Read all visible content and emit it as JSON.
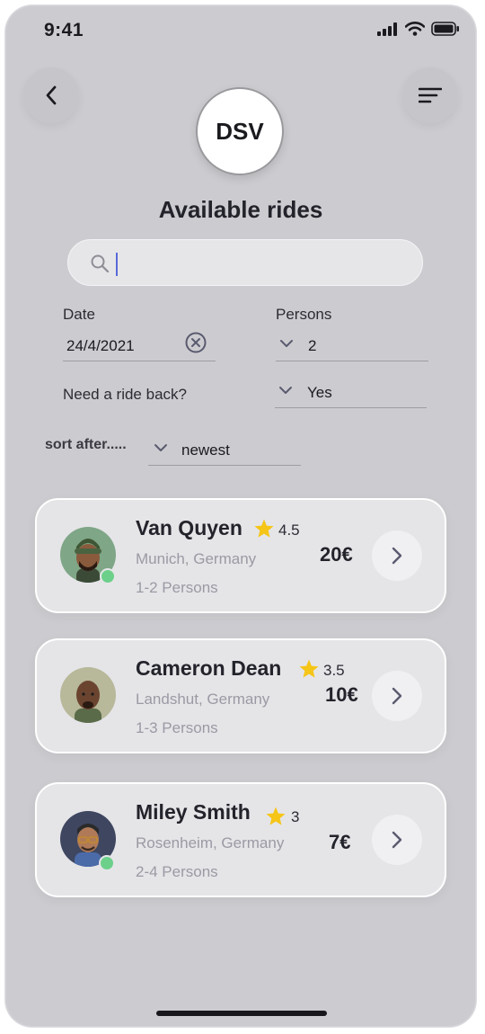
{
  "status_bar": {
    "time": "9:41"
  },
  "header": {
    "logo_text": "DSV",
    "title": "Available rides"
  },
  "search": {
    "value": "",
    "placeholder": ""
  },
  "filters": {
    "date_label": "Date",
    "date_value": "24/4/2021",
    "persons_label": "Persons",
    "persons_value": "2",
    "ride_back_label": "Need a ride back?",
    "ride_back_value": "Yes",
    "sort_label": "sort after.....",
    "sort_value": "newest"
  },
  "rides": [
    {
      "name": "Van Quyen",
      "rating": "4.5",
      "location": "Munich, Germany",
      "persons": "1-2 Persons",
      "price": "20€",
      "online": true
    },
    {
      "name": "Cameron Dean",
      "rating": "3.5",
      "location": "Landshut, Germany",
      "persons": "1-3 Persons",
      "price": "10€",
      "online": false
    },
    {
      "name": "Miley Smith",
      "rating": "3",
      "location": "Rosenheim, Germany",
      "persons": "2-4 Persons",
      "price": "7€",
      "online": true
    }
  ],
  "colors": {
    "background": "#ccccd0",
    "card": "#e5e5e8",
    "star": "#f5c518",
    "online": "#6dd08a",
    "caret": "#5869d8"
  }
}
